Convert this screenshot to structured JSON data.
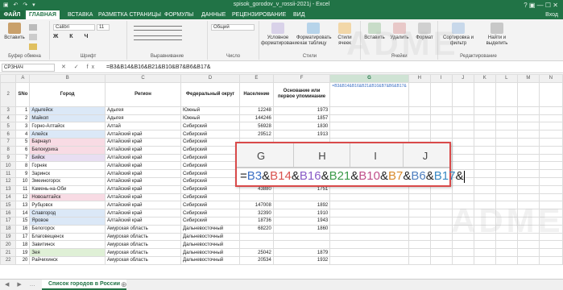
{
  "window": {
    "title": "spisok_gorodov_v_rossii-2021j - Excel",
    "controls": "?   ▣   —   ☐   ✕",
    "quick_access": "▣ ↶ ↷ ▾"
  },
  "tabs": [
    "ФАЙЛ",
    "ГЛАВНАЯ",
    "ВСТАВКА",
    "РАЗМЕТКА СТРАНИЦЫ",
    "ФОРМУЛЫ",
    "ДАННЫЕ",
    "РЕЦЕНЗИРОВАНИЕ",
    "ВИД"
  ],
  "account": "Вход",
  "ribbon": {
    "paste_label": "Вставить",
    "clipboard_label": "Буфер обмена",
    "font_label": "Шрифт",
    "font_name": "Calibri",
    "font_size": "11",
    "align_label": "Выравнивание",
    "number_label": "Число",
    "number_format": "Общий",
    "cond_format": "Условное форматирование",
    "format_table": "Форматировать как таблицу",
    "cell_styles": "Стили ячеек",
    "styles_label": "Стили",
    "insert_label": "Вставить",
    "delete_label": "Удалить",
    "format_label": "Формат",
    "cells_label": "Ячейки",
    "sort_label": "Сортировка и фильтр",
    "find_label": "Найти и выделить",
    "editing_label": "Редактирование"
  },
  "formula_bar": {
    "name_box": "СРЗНАЧ",
    "icons": "✕ ✓ fx",
    "formula": "=B3&B14&B16&B21&B10&B7&B6&B17&"
  },
  "columns": [
    "A",
    "B",
    "C",
    "D",
    "E",
    "F",
    "G",
    "H",
    "I",
    "J",
    "K",
    "L",
    "M",
    "N"
  ],
  "headers": {
    "num": "SNo",
    "city": "Город",
    "region": "Регион",
    "district": "Федеральный округ",
    "population": "Население",
    "founded": "Основание или первое упоминание"
  },
  "rows": [
    {
      "n": "3",
      "no": "1",
      "city": "Адыгейск",
      "region": "Адыгея",
      "district": "Южный",
      "pop": "12248",
      "year": "1973"
    },
    {
      "n": "4",
      "no": "2",
      "city": "Майкоп",
      "region": "Адыгея",
      "district": "Южный",
      "pop": "144246",
      "year": "1857"
    },
    {
      "n": "5",
      "no": "3",
      "city": "Горно-Алтайск",
      "region": "Алтай",
      "district": "Сибирский",
      "pop": "56928",
      "year": "1830"
    },
    {
      "n": "6",
      "no": "4",
      "city": "Алейск",
      "region": "Алтайский край",
      "district": "Сибирский",
      "pop": "29512",
      "year": "1913"
    },
    {
      "n": "7",
      "no": "5",
      "city": "Барнаул",
      "region": "Алтайский край",
      "district": "Сибирский",
      "pop": "",
      "year": ""
    },
    {
      "n": "8",
      "no": "6",
      "city": "Белокуриха",
      "region": "Алтайский край",
      "district": "Сибирский",
      "pop": "",
      "year": ""
    },
    {
      "n": "9",
      "no": "7",
      "city": "Бийск",
      "region": "Алтайский край",
      "district": "Сибирский",
      "pop": "",
      "year": ""
    },
    {
      "n": "10",
      "no": "8",
      "city": "Горняк",
      "region": "Алтайский край",
      "district": "Сибирский",
      "pop": "",
      "year": ""
    },
    {
      "n": "11",
      "no": "9",
      "city": "Заринск",
      "region": "Алтайский край",
      "district": "Сибирский",
      "pop": "",
      "year": ""
    },
    {
      "n": "12",
      "no": "10",
      "city": "Змеиногорск",
      "region": "Алтайский край",
      "district": "Сибирский",
      "pop": "",
      "year": ""
    },
    {
      "n": "13",
      "no": "11",
      "city": "Камень-на-Оби",
      "region": "Алтайский край",
      "district": "Сибирский",
      "pop": "43880",
      "year": "1751"
    },
    {
      "n": "14",
      "no": "12",
      "city": "Новоалтайск",
      "region": "Алтайский край",
      "district": "Сибирский",
      "pop": "",
      "year": ""
    },
    {
      "n": "15",
      "no": "13",
      "city": "Рубцовск",
      "region": "Алтайский край",
      "district": "Сибирский",
      "pop": "147008",
      "year": "1892"
    },
    {
      "n": "16",
      "no": "14",
      "city": "Славгород",
      "region": "Алтайский край",
      "district": "Сибирский",
      "pop": "32390",
      "year": "1910"
    },
    {
      "n": "17",
      "no": "15",
      "city": "Яровое",
      "region": "Алтайский край",
      "district": "Сибирский",
      "pop": "18736",
      "year": "1943"
    },
    {
      "n": "18",
      "no": "16",
      "city": "Белогорск",
      "region": "Амурская область",
      "district": "Дальневосточный",
      "pop": "68220",
      "year": "1860"
    },
    {
      "n": "19",
      "no": "17",
      "city": "Благовещенск",
      "region": "Амурская область",
      "district": "Дальневосточный",
      "pop": "",
      "year": ""
    },
    {
      "n": "20",
      "no": "18",
      "city": "Завитинск",
      "region": "Амурская область",
      "district": "Дальневосточный",
      "pop": "",
      "year": ""
    },
    {
      "n": "21",
      "no": "19",
      "city": "Зея",
      "region": "Амурская область",
      "district": "Дальневосточный",
      "pop": "25042",
      "year": "1879"
    },
    {
      "n": "22",
      "no": "20",
      "city": "Райчихинск",
      "region": "Амурская область",
      "district": "Дальневосточный",
      "pop": "20534",
      "year": "1932"
    }
  ],
  "zoom": {
    "columns": [
      "G",
      "H",
      "I",
      "J"
    ],
    "formula_parts": [
      {
        "t": "=",
        "c": "#222222"
      },
      {
        "t": "B3",
        "c": "#3b6fc4"
      },
      {
        "t": "&",
        "c": "#222222"
      },
      {
        "t": "B14",
        "c": "#d9534f"
      },
      {
        "t": "&",
        "c": "#222222"
      },
      {
        "t": "B16",
        "c": "#8a5cc7"
      },
      {
        "t": "&",
        "c": "#222222"
      },
      {
        "t": "B21",
        "c": "#3c9a4a"
      },
      {
        "t": "&",
        "c": "#222222"
      },
      {
        "t": "B10",
        "c": "#c0508a"
      },
      {
        "t": "&",
        "c": "#222222"
      },
      {
        "t": "B7",
        "c": "#d98a2b"
      },
      {
        "t": "&",
        "c": "#222222"
      },
      {
        "t": "B6",
        "c": "#4f7fbf"
      },
      {
        "t": "&",
        "c": "#222222"
      },
      {
        "t": "B17",
        "c": "#3b8ac4"
      },
      {
        "t": "&",
        "c": "#222222"
      }
    ]
  },
  "watermark": "ADME",
  "sheet_tab": "Список городов в России",
  "sheet_nav": "◀ ▶ …",
  "sheet_add": "⊕",
  "colors": {
    "excel_green": "#217346",
    "zoom_border": "#d94a4a"
  }
}
